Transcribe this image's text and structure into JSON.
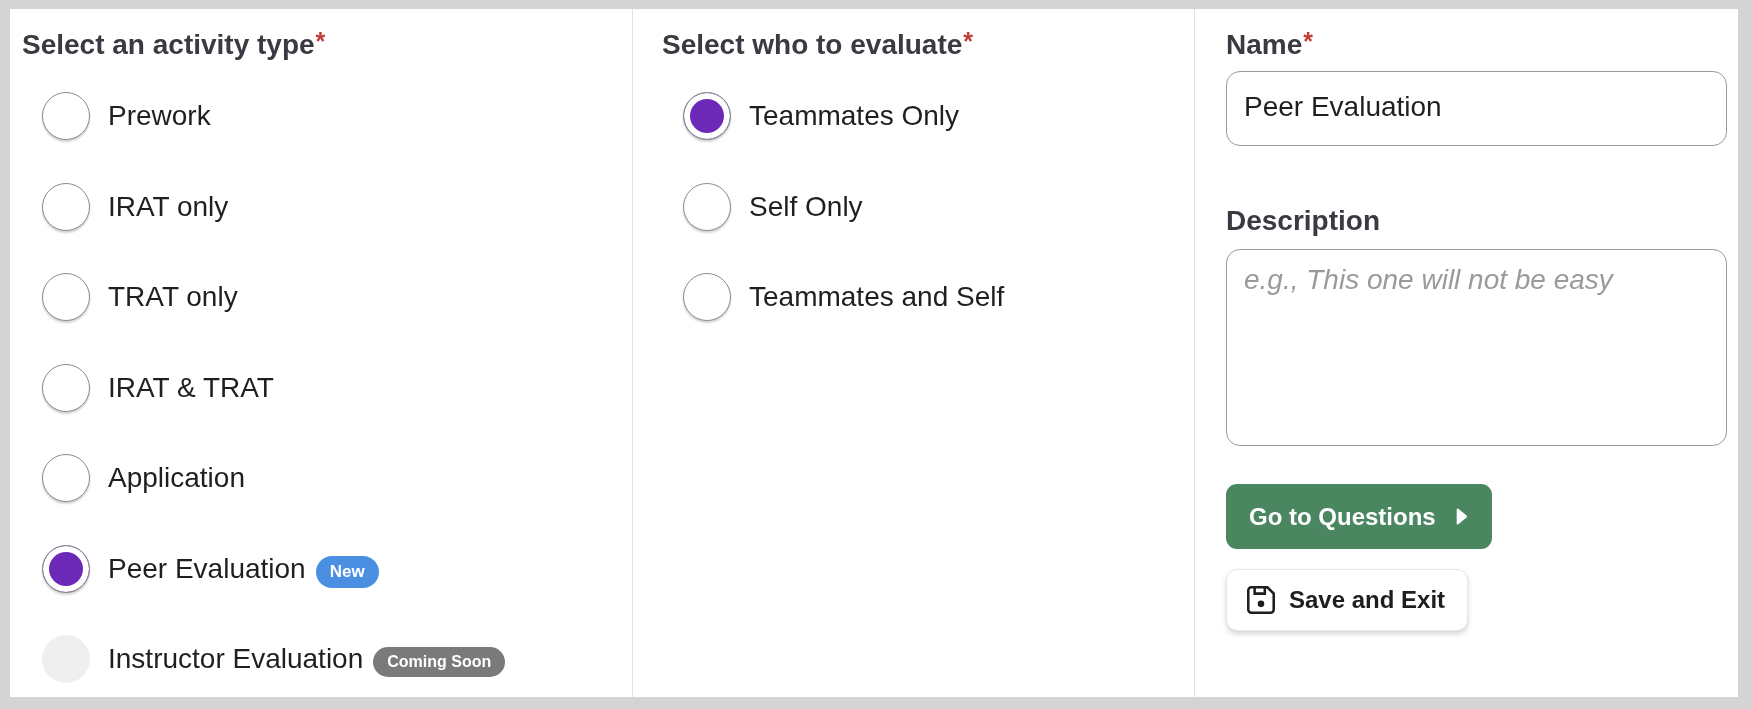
{
  "activity_type": {
    "label": "Select an activity type",
    "required_mark": "*",
    "options": [
      {
        "label": "Prework",
        "selected": false,
        "disabled": false
      },
      {
        "label": "IRAT only",
        "selected": false,
        "disabled": false
      },
      {
        "label": "TRAT only",
        "selected": false,
        "disabled": false
      },
      {
        "label": "IRAT & TRAT",
        "selected": false,
        "disabled": false
      },
      {
        "label": "Application",
        "selected": false,
        "disabled": false
      },
      {
        "label": "Peer Evaluation",
        "selected": true,
        "disabled": false,
        "badge": {
          "text": "New",
          "kind": "new"
        }
      },
      {
        "label": "Instructor Evaluation",
        "selected": false,
        "disabled": true,
        "badge": {
          "text": "Coming Soon",
          "kind": "coming_soon"
        }
      }
    ]
  },
  "evaluatees": {
    "label": "Select who to evaluate",
    "required_mark": "*",
    "options": [
      {
        "label": "Teammates Only",
        "selected": true,
        "disabled": false
      },
      {
        "label": "Self Only",
        "selected": false,
        "disabled": false
      },
      {
        "label": "Teammates and Self",
        "selected": false,
        "disabled": false
      }
    ]
  },
  "details": {
    "name": {
      "label": "Name",
      "required_mark": "*",
      "value": "Peer Evaluation"
    },
    "description": {
      "label": "Description",
      "placeholder": "e.g., This one will not be easy"
    }
  },
  "buttons": [
    {
      "label": "Go to Questions",
      "kind": "primary"
    },
    {
      "label": "Save and Exit",
      "kind": "secondary"
    }
  ]
}
